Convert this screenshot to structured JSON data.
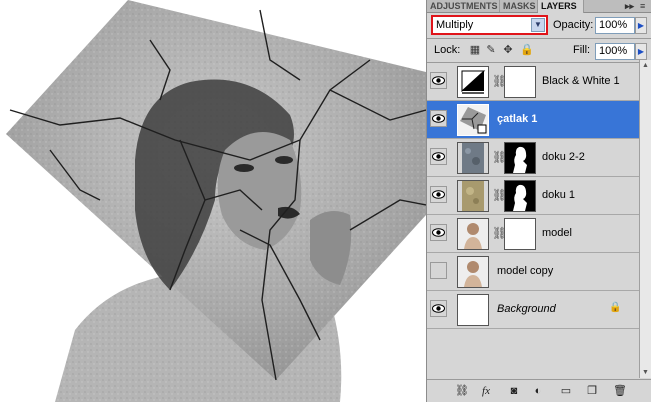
{
  "panel": {
    "tabs": [
      "ADJUSTMENTS",
      "MASKS",
      "LAYERS"
    ],
    "active_tab": "LAYERS",
    "blend_mode": "Multiply",
    "opacity_label": "Opacity:",
    "opacity_value": "100%",
    "lock_label": "Lock:",
    "fill_label": "Fill:",
    "fill_value": "100%"
  },
  "layers": [
    {
      "name": "Black & White 1",
      "visible": true,
      "selected": false,
      "italic": false
    },
    {
      "name": "çatlak 1",
      "visible": true,
      "selected": true,
      "italic": false
    },
    {
      "name": "doku 2-2",
      "visible": true,
      "selected": false,
      "italic": false
    },
    {
      "name": "doku 1",
      "visible": true,
      "selected": false,
      "italic": false
    },
    {
      "name": "model",
      "visible": true,
      "selected": false,
      "italic": false
    },
    {
      "name": "model copy",
      "visible": false,
      "selected": false,
      "italic": false
    },
    {
      "name": "Background",
      "visible": true,
      "selected": false,
      "italic": true
    }
  ],
  "colors": {
    "selected_layer": "#3875d7",
    "blend_highlight": "#e0141a",
    "panel_bg": "#d6d6d6"
  },
  "icons": {
    "eye": "eye-icon",
    "link": "chain-link-icon",
    "lock": "padlock-icon",
    "footer": [
      "link-layers-icon",
      "fx-icon",
      "add-mask-icon",
      "adjustment-layer-icon",
      "new-group-icon",
      "new-layer-icon",
      "trash-icon"
    ]
  }
}
